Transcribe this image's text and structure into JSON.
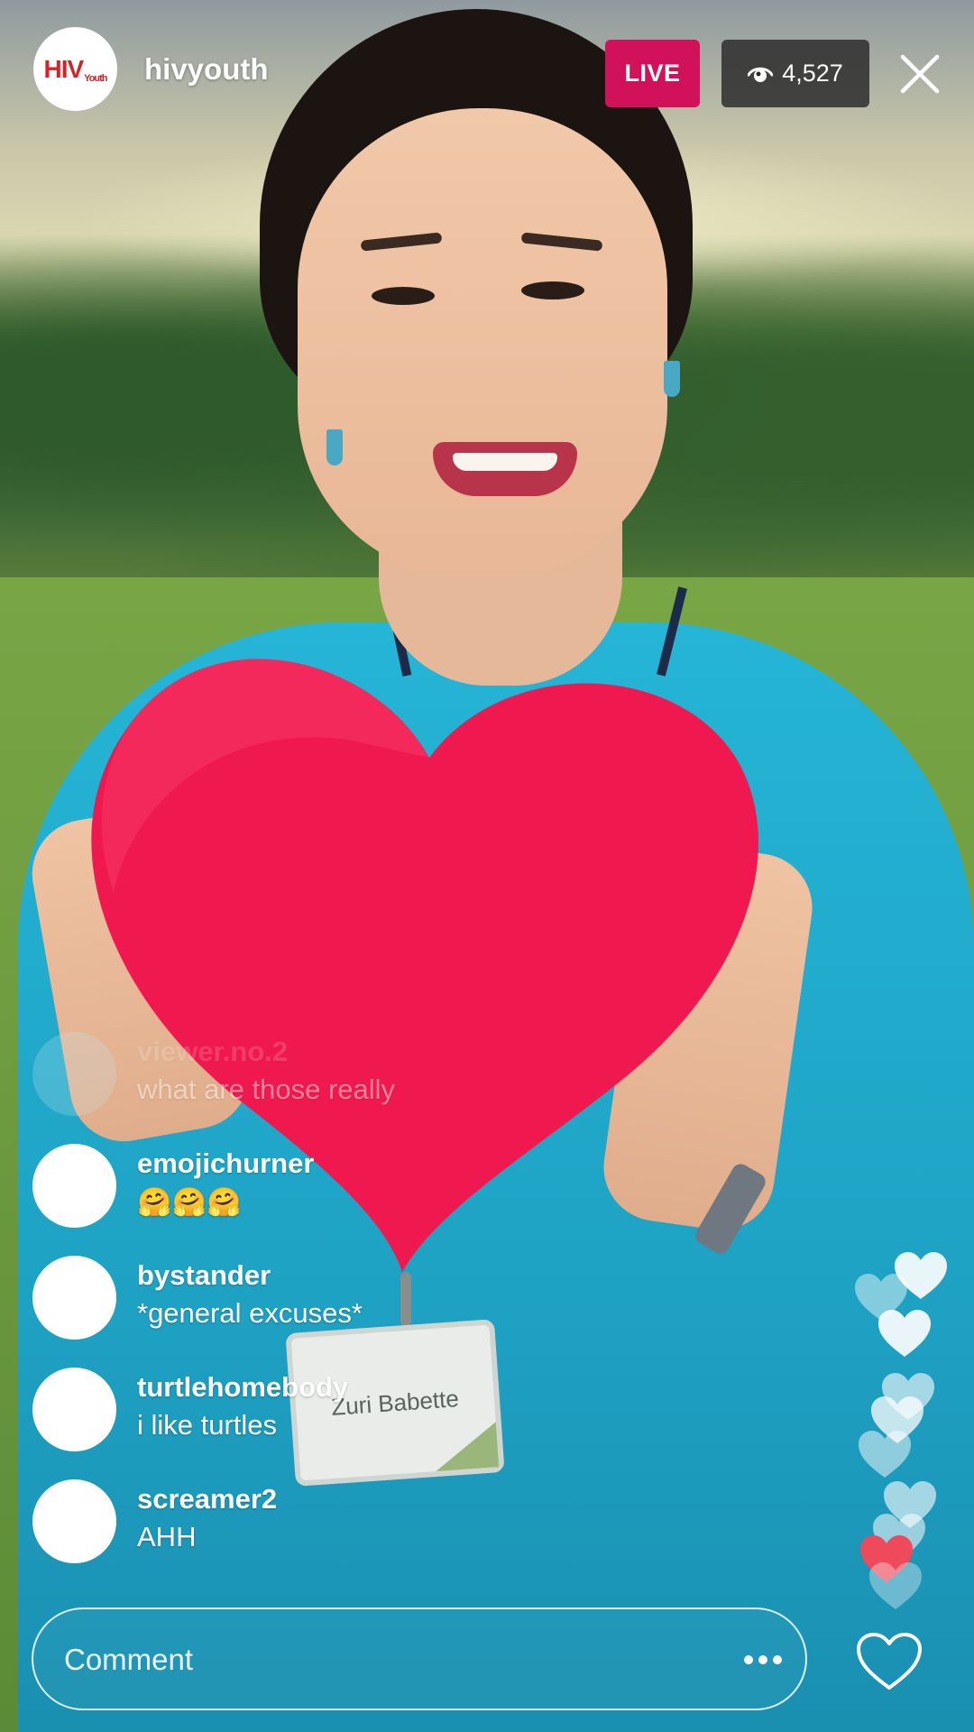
{
  "header": {
    "avatar_logo_main": "HIV",
    "avatar_logo_small": "Youth",
    "username": "hivyouth",
    "live_label": "LIVE",
    "viewer_count": "4,527"
  },
  "video": {
    "badge_name": "Zuri Babette"
  },
  "comments": [
    {
      "username": "viewer.no.2",
      "text": "what are those really",
      "faded": true
    },
    {
      "username": "emojichurner",
      "text": "🤗🤗🤗",
      "faded": false
    },
    {
      "username": "bystander",
      "text": "*general excuses*",
      "faded": false
    },
    {
      "username": "turtlehomebody",
      "text": "i like turtles",
      "faded": false
    },
    {
      "username": "screamer2",
      "text": "AHH",
      "faded": false
    }
  ],
  "composer": {
    "placeholder": "Comment"
  },
  "icons": {
    "viewers": "eye-icon",
    "close": "close-icon",
    "more": "more-icon",
    "like": "heart-icon"
  },
  "colors": {
    "live_badge": "#d1125b",
    "heart_red": "#ee4a5c",
    "viewer_pill": "#2d2d2d"
  }
}
